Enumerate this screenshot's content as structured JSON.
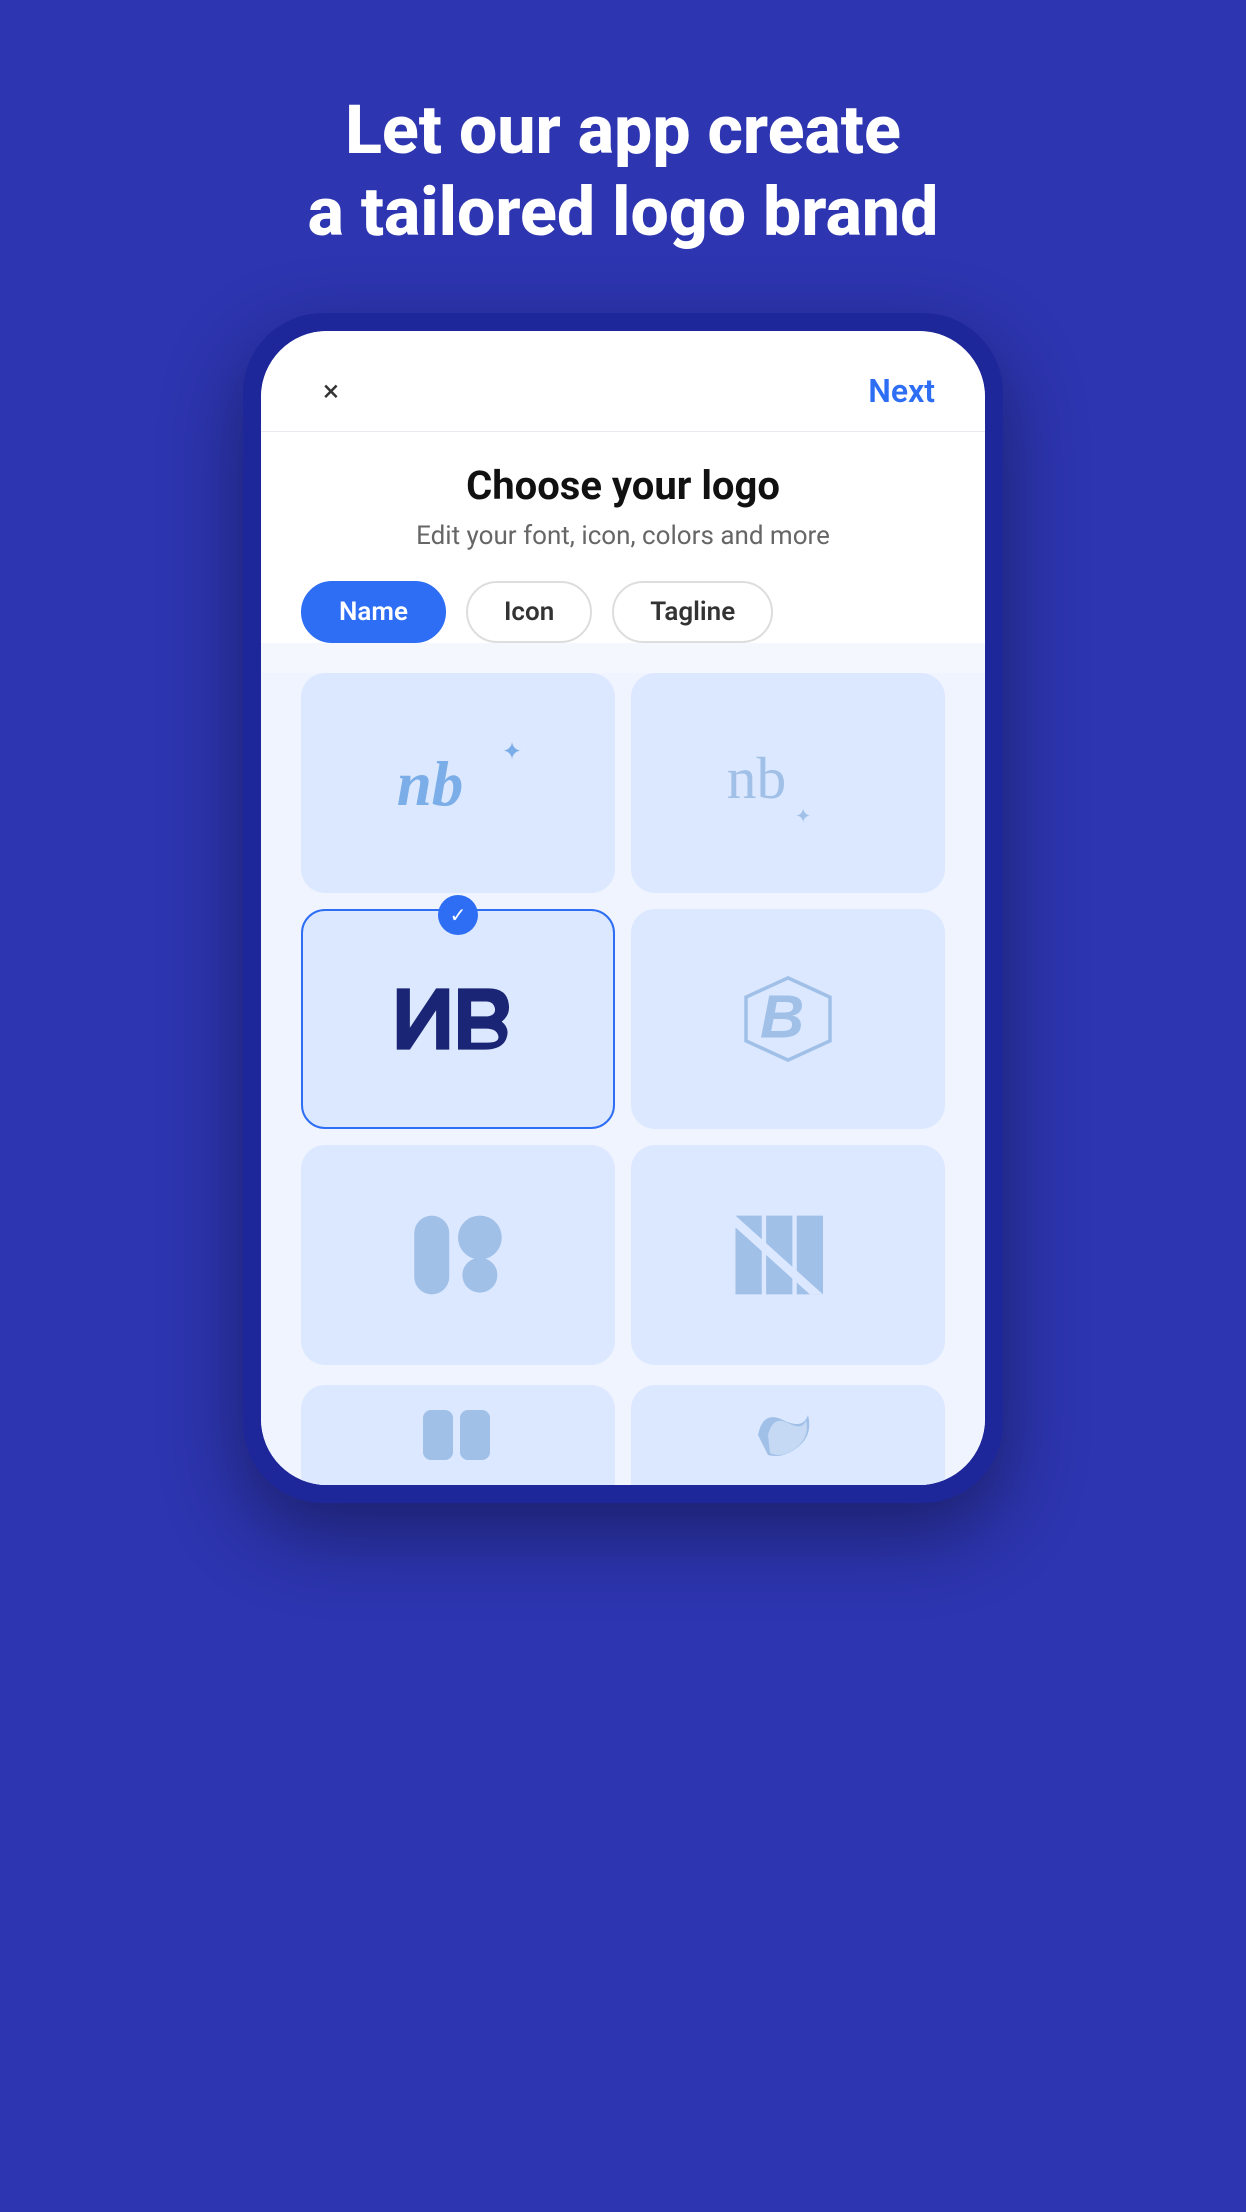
{
  "page": {
    "title_line1": "Let our app create",
    "title_line2": "a tailored logo brand",
    "background_color": "#2d35b0"
  },
  "phone": {
    "header": {
      "close_label": "×",
      "next_label": "Next"
    },
    "content": {
      "title": "Choose your logo",
      "subtitle": "Edit your font, icon, colors and more",
      "tabs": [
        {
          "label": "Name",
          "active": true
        },
        {
          "label": "Icon",
          "active": false
        },
        {
          "label": "Tagline",
          "active": false
        }
      ],
      "logos": [
        {
          "id": "logo1",
          "type": "nb-script-sparkle",
          "selected": false
        },
        {
          "id": "logo2",
          "type": "nb-serif-sparkle",
          "selected": false
        },
        {
          "id": "logo3",
          "type": "NB-bold",
          "selected": true
        },
        {
          "id": "logo4",
          "type": "B-geometric",
          "selected": false
        },
        {
          "id": "logo5",
          "type": "abstract-shapes",
          "selected": false
        },
        {
          "id": "logo6",
          "type": "N-stripes",
          "selected": false
        }
      ]
    }
  }
}
